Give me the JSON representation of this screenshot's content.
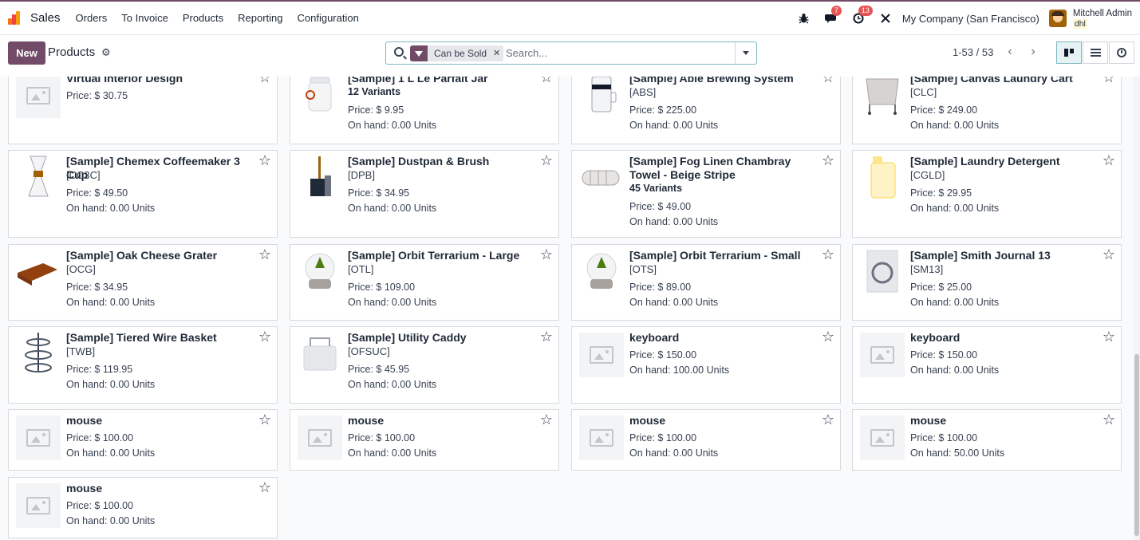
{
  "app": {
    "name": "Sales"
  },
  "nav": [
    "Orders",
    "To Invoice",
    "Products",
    "Reporting",
    "Configuration"
  ],
  "topbar": {
    "messages_count": "7",
    "activities_count": "13",
    "company": "My Company (San Francisco)",
    "user_name": "Mitchell Admin",
    "db_name": "dhl"
  },
  "control": {
    "new_label": "New",
    "title": "Products",
    "facet_label": "Can be Sold",
    "search_placeholder": "Search...",
    "pager": "1-53 / 53"
  },
  "colors": {
    "brand": "#714b67",
    "badge": "#e55353",
    "accent": "#7eb8c0"
  },
  "products": [
    {
      "name": "Virtual Interior Design",
      "code": "",
      "variants": "",
      "price": "Price: $ 30.75",
      "onhand": "",
      "img": "placeholder"
    },
    {
      "name": "[Sample] 1 L Le Parfait Jar",
      "code": "",
      "variants": "12 Variants",
      "price": "Price: $ 9.95",
      "onhand": "On hand: 0.00 Units",
      "img": "jar"
    },
    {
      "name": "[Sample] Able Brewing System",
      "code": "[ABS]",
      "variants": "",
      "price": "Price: $ 225.00",
      "onhand": "On hand: 0.00 Units",
      "img": "brew"
    },
    {
      "name": "[Sample] Canvas Laundry Cart",
      "code": "[CLC]",
      "variants": "",
      "price": "Price: $ 249.00",
      "onhand": "On hand: 0.00 Units",
      "img": "cart"
    },
    {
      "name": "[Sample] Chemex Coffeemaker 3 Cup",
      "code": "[CC3C]",
      "variants": "",
      "price": "Price: $ 49.50",
      "onhand": "On hand: 0.00 Units",
      "img": "chemex"
    },
    {
      "name": "[Sample] Dustpan & Brush",
      "code": "[DPB]",
      "variants": "",
      "price": "Price: $ 34.95",
      "onhand": "On hand: 0.00 Units",
      "img": "dustpan"
    },
    {
      "name": "[Sample] Fog Linen Chambray Towel - Beige Stripe",
      "code": "",
      "variants": "45 Variants",
      "price": "Price: $ 49.00",
      "onhand": "On hand: 0.00 Units",
      "img": "towel"
    },
    {
      "name": "[Sample] Laundry Detergent",
      "code": "[CGLD]",
      "variants": "",
      "price": "Price: $ 29.95",
      "onhand": "On hand: 0.00 Units",
      "img": "detergent"
    },
    {
      "name": "[Sample] Oak Cheese Grater",
      "code": "[OCG]",
      "variants": "",
      "price": "Price: $ 34.95",
      "onhand": "On hand: 0.00 Units",
      "img": "grater"
    },
    {
      "name": "[Sample] Orbit Terrarium - Large",
      "code": "[OTL]",
      "variants": "",
      "price": "Price: $ 109.00",
      "onhand": "On hand: 0.00 Units",
      "img": "terrarium"
    },
    {
      "name": "[Sample] Orbit Terrarium - Small",
      "code": "[OTS]",
      "variants": "",
      "price": "Price: $ 89.00",
      "onhand": "On hand: 0.00 Units",
      "img": "terrarium"
    },
    {
      "name": "[Sample] Smith Journal 13",
      "code": "[SM13]",
      "variants": "",
      "price": "Price: $ 25.00",
      "onhand": "On hand: 0.00 Units",
      "img": "journal"
    },
    {
      "name": "[Sample] Tiered Wire Basket",
      "code": "[TWB]",
      "variants": "",
      "price": "Price: $ 119.95",
      "onhand": "On hand: 0.00 Units",
      "img": "basket"
    },
    {
      "name": "[Sample] Utility Caddy",
      "code": "[OFSUC]",
      "variants": "",
      "price": "Price: $ 45.95",
      "onhand": "On hand: 0.00 Units",
      "img": "caddy"
    },
    {
      "name": "keyboard",
      "code": "",
      "variants": "",
      "price": "Price: $ 150.00",
      "onhand": "On hand: 100.00 Units",
      "img": "placeholder"
    },
    {
      "name": "keyboard",
      "code": "",
      "variants": "",
      "price": "Price: $ 150.00",
      "onhand": "On hand: 0.00 Units",
      "img": "placeholder"
    },
    {
      "name": "mouse",
      "code": "",
      "variants": "",
      "price": "Price: $ 100.00",
      "onhand": "On hand: 0.00 Units",
      "img": "placeholder"
    },
    {
      "name": "mouse",
      "code": "",
      "variants": "",
      "price": "Price: $ 100.00",
      "onhand": "On hand: 0.00 Units",
      "img": "placeholder"
    },
    {
      "name": "mouse",
      "code": "",
      "variants": "",
      "price": "Price: $ 100.00",
      "onhand": "On hand: 0.00 Units",
      "img": "placeholder"
    },
    {
      "name": "mouse",
      "code": "",
      "variants": "",
      "price": "Price: $ 100.00",
      "onhand": "On hand: 50.00 Units",
      "img": "placeholder"
    },
    {
      "name": "mouse",
      "code": "",
      "variants": "",
      "price": "Price: $ 100.00",
      "onhand": "On hand: 0.00 Units",
      "img": "placeholder"
    }
  ]
}
